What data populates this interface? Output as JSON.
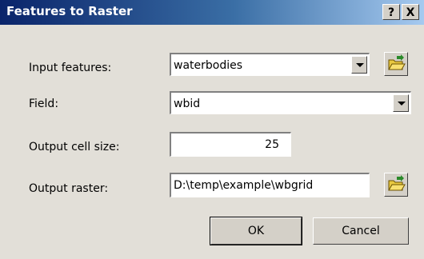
{
  "window": {
    "title": "Features to Raster",
    "help_label": "?",
    "close_label": "X"
  },
  "form": {
    "input_features": {
      "label": "Input features:",
      "value": "waterbodies"
    },
    "field": {
      "label": "Field:",
      "value": "wbid"
    },
    "cell_size": {
      "label": "Output cell size:",
      "value": "25"
    },
    "output_raster": {
      "label": "Output raster:",
      "value": "D:\\temp\\example\\wbgrid"
    }
  },
  "buttons": {
    "ok": "OK",
    "cancel": "Cancel"
  },
  "icons": {
    "browse_input": "open-folder-icon",
    "browse_output": "open-folder-icon",
    "dropdown": "chevron-down-icon"
  }
}
